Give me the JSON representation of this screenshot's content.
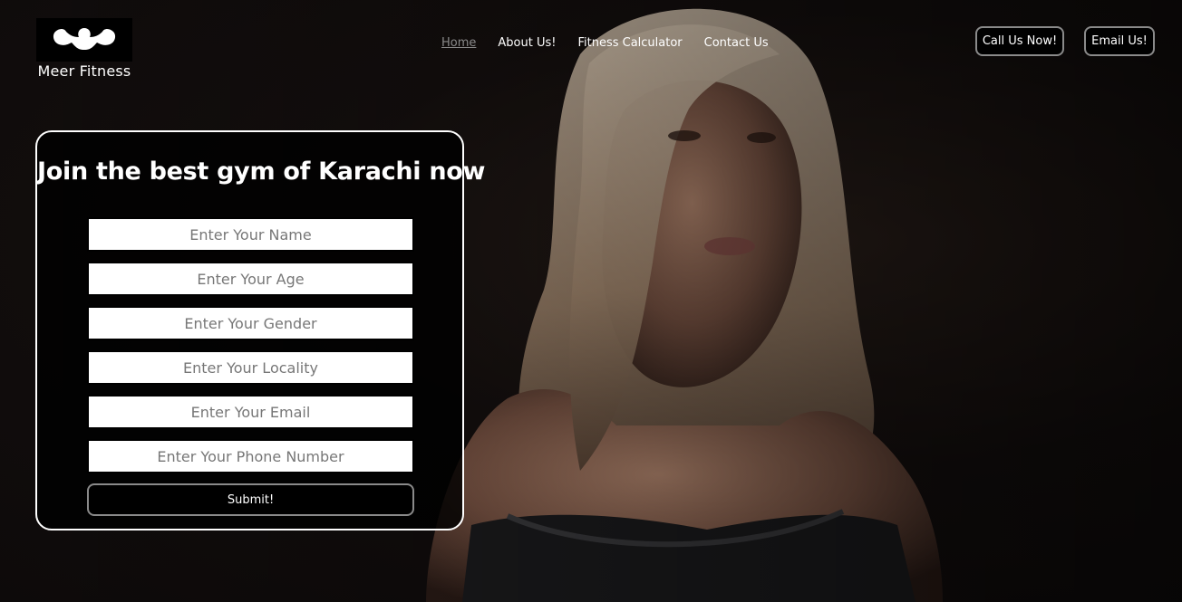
{
  "brand": {
    "name": "Meer Fitness",
    "logo_icon": "flexing-muscles-icon"
  },
  "nav": {
    "items": [
      {
        "label": "Home",
        "active": true
      },
      {
        "label": "About Us!",
        "active": false
      },
      {
        "label": "Fitness Calculator",
        "active": false
      },
      {
        "label": "Contact Us",
        "active": false
      }
    ]
  },
  "actions": {
    "call_label": "Call Us Now!",
    "email_label": "Email Us!"
  },
  "form": {
    "title": "Join the best gym of Karachi now",
    "fields": [
      {
        "placeholder": "Enter Your Name",
        "value": ""
      },
      {
        "placeholder": "Enter Your Age",
        "value": ""
      },
      {
        "placeholder": "Enter Your Gender",
        "value": ""
      },
      {
        "placeholder": "Enter Your Locality",
        "value": ""
      },
      {
        "placeholder": "Enter Your Email",
        "value": ""
      },
      {
        "placeholder": "Enter Your Phone Number",
        "value": ""
      }
    ],
    "submit_label": "Submit!"
  },
  "colors": {
    "background": "#0e0b0b",
    "card_border": "#ffffff",
    "button_border": "#8a8a8a",
    "nav_active": "#8a8a8a"
  }
}
